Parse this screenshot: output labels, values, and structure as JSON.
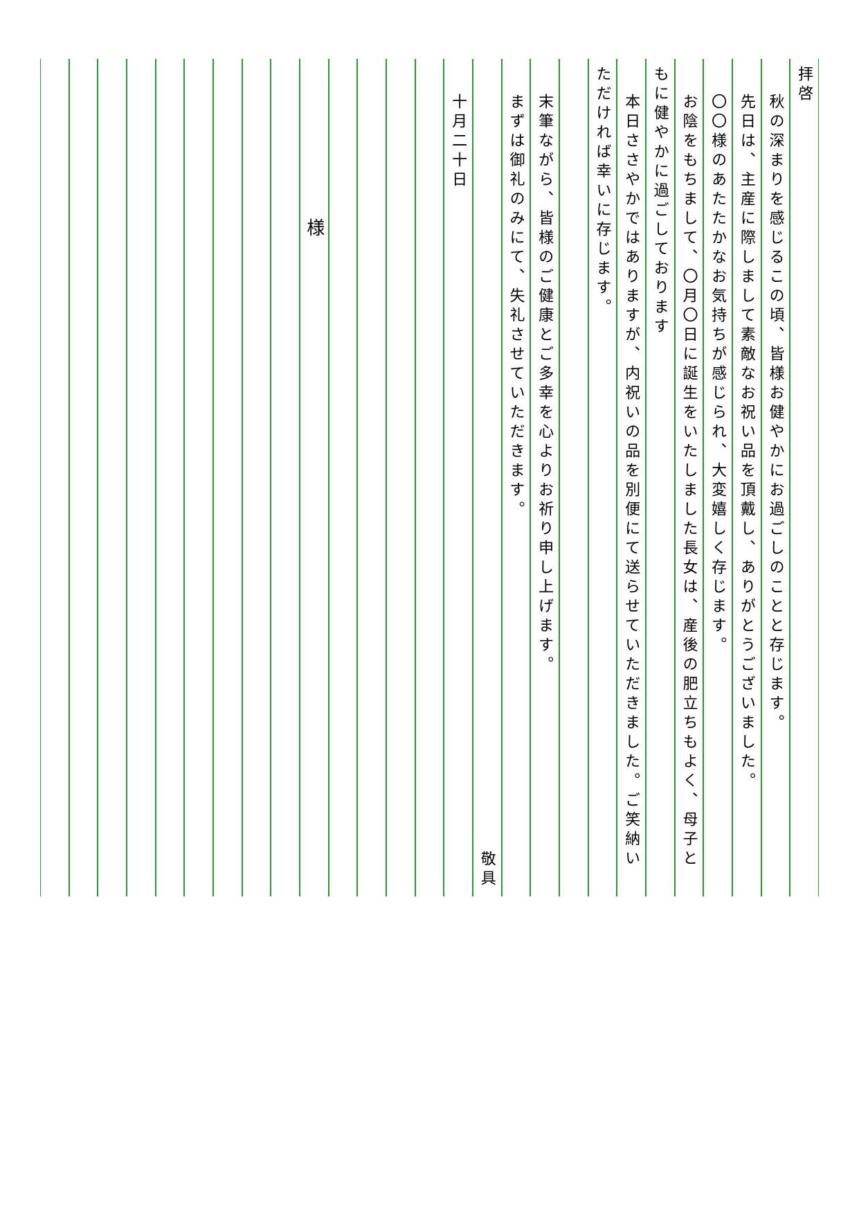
{
  "letter": {
    "columns": [
      {
        "text": "拝啓",
        "class": ""
      },
      {
        "text": "秋の深まりを感じるこの頃、皆様お健やかにお過ごしのことと存じます。",
        "class": "indent1"
      },
      {
        "text": "先日は、主産に際しまして素敵なお祝い品を頂戴し、ありがとうございました。",
        "class": "indent1"
      },
      {
        "text": "〇〇様のあたたかなお気持ちが感じられ、大変嬉しく存じます。",
        "class": "indent1"
      },
      {
        "text": "お陰をもちまして、〇月〇日に誕生をいたしました長女は、産後の肥立ちもよく、母子と",
        "class": "indent1"
      },
      {
        "text": "もに健やかに過ごしております",
        "class": ""
      },
      {
        "text": "本日ささやかではありますが、内祝いの品を別便にて送らせていただきました。ご笑納い",
        "class": "indent1"
      },
      {
        "text": "ただければ幸いに存じます。",
        "class": ""
      },
      {
        "text": "",
        "class": ""
      },
      {
        "text": "末筆ながら、皆様のご健康とご多幸を心よりお祈り申し上げます。",
        "class": "indent1"
      },
      {
        "text": "まずは御礼のみにて、失礼させていただきます。",
        "class": "indent1"
      },
      {
        "text": "敬具",
        "class": "bottom"
      },
      {
        "text": "十月二十日",
        "class": "indent1"
      },
      {
        "text": "",
        "class": ""
      },
      {
        "text": "",
        "class": ""
      },
      {
        "text": "",
        "class": ""
      },
      {
        "text": "",
        "class": ""
      },
      {
        "text": "様",
        "class": "addressee"
      },
      {
        "text": "",
        "class": ""
      },
      {
        "text": "",
        "class": ""
      },
      {
        "text": "",
        "class": ""
      },
      {
        "text": "",
        "class": ""
      },
      {
        "text": "",
        "class": ""
      },
      {
        "text": "",
        "class": ""
      },
      {
        "text": "",
        "class": ""
      },
      {
        "text": "",
        "class": ""
      },
      {
        "text": "",
        "class": ""
      }
    ]
  }
}
